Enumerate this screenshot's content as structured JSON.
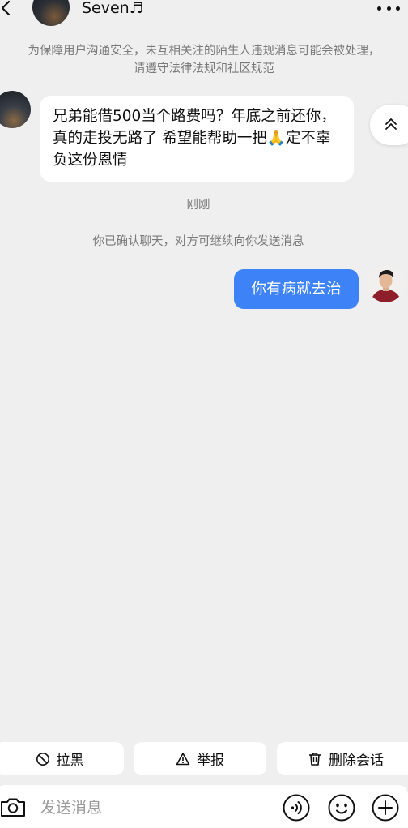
{
  "header": {
    "contact_name": "Seven♬",
    "back_icon": "chevron-left-icon",
    "more_icon": "more-dots-icon"
  },
  "notice": {
    "text": "为保障用户沟通安全，未互相关注的陌生人违规消息可能会被处理，请遵守法律法规和社区规范"
  },
  "messages": {
    "incoming": {
      "text": "兄弟能借500当个路费吗？年底之前还你，真的走投无路了 希望能帮助一把🙏定不辜负这份恩情"
    },
    "timestamp": "刚刚",
    "system": "你已确认聊天，对方可继续向你发送消息",
    "outgoing": {
      "text": "你有病就去治"
    }
  },
  "actions": {
    "block_label": "拉黑",
    "report_label": "举报",
    "delete_label": "删除会话"
  },
  "input_bar": {
    "placeholder": "发送消息"
  },
  "colors": {
    "background": "#efefef",
    "outgoing_bubble": "#3d82f6",
    "incoming_bubble": "#ffffff",
    "muted_text": "#7a7a7a"
  }
}
